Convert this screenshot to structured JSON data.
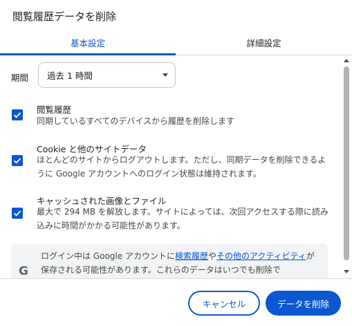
{
  "dialog": {
    "title": "閲覧履歴データを削除"
  },
  "tabs": [
    {
      "label": "基本設定",
      "selected": true
    },
    {
      "label": "詳細設定",
      "selected": false
    }
  ],
  "time_range": {
    "label": "期間",
    "selected": "過去 1 時間"
  },
  "options": [
    {
      "title": "閲覧履歴",
      "description": "同期しているすべてのデバイスから履歴を削除します",
      "checked": true
    },
    {
      "title": "Cookie と他のサイトデータ",
      "description": "ほとんどのサイトからログアウトします。ただし、同期データを削除できるように Google アカウントへのログイン状態は維持されます。",
      "checked": true
    },
    {
      "title": "キャッシュされた画像とファイル",
      "description": "最大で 294 MB を解放します。サイトによっては、次回アクセスする際に読み込みに時間がかかる可能性があります。",
      "checked": true
    }
  ],
  "info": {
    "icon": "google-g-icon",
    "text_before": "ログイン中は Google アカウントに",
    "link1": "検索履歴",
    "text_mid": "や",
    "link2": "その他のアクティビティ",
    "text_after": "が保存される可能性があります。これらのデータはいつでも削除で"
  },
  "footer": {
    "cancel_label": "キャンセル",
    "delete_label": "データを削除"
  },
  "colors": {
    "accent": "#0b57d0",
    "info_background": "#f1f3f4",
    "divider": "#dadce0"
  }
}
